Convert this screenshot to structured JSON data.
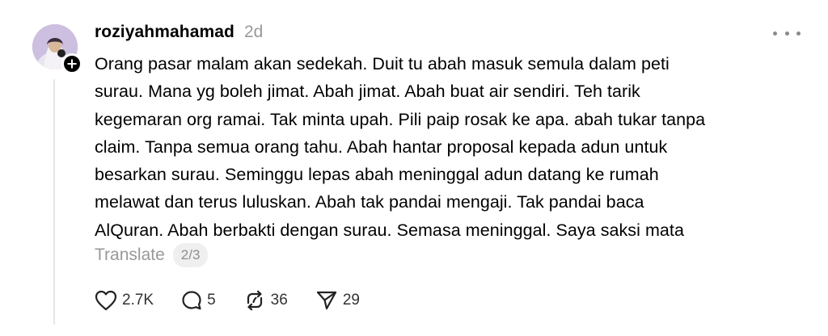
{
  "post": {
    "username": "roziyahmahamad",
    "timestamp": "2d",
    "body": "Orang pasar malam akan sedekah. Duit tu abah masuk semula dalam peti\nsurau. Mana yg boleh jimat. Abah jimat. Abah buat air sendiri. Teh tarik\nkegemaran org ramai. Tak minta upah. Pili paip rosak ke apa. abah tukar tanpa\nclaim. Tanpa semua orang tahu. Abah hantar proposal kepada adun untuk\nbesarkan surau. Seminggu lepas abah meninggal adun datang ke rumah\nmelawat dan terus luluskan. Abah tak pandai mengaji. Tak pandai baca\nAlQuran. Abah berbakti dengan surau. Semasa meninggal. Saya saksi mata",
    "translate_label": "Translate",
    "translate_count": "2/3"
  },
  "actions": {
    "like_count": "2.7K",
    "comment_count": "5",
    "repost_count": "36",
    "share_count": "29"
  },
  "icons": {
    "like": "heart-icon",
    "comment": "comment-bubble-icon",
    "repost": "repost-icon",
    "share": "send-icon",
    "more": "more-dots-icon",
    "follow": "plus-icon"
  },
  "colors": {
    "text": "#000000",
    "muted": "#999999",
    "badge_bg": "#efefef",
    "thread_line": "#e5e5e5"
  }
}
